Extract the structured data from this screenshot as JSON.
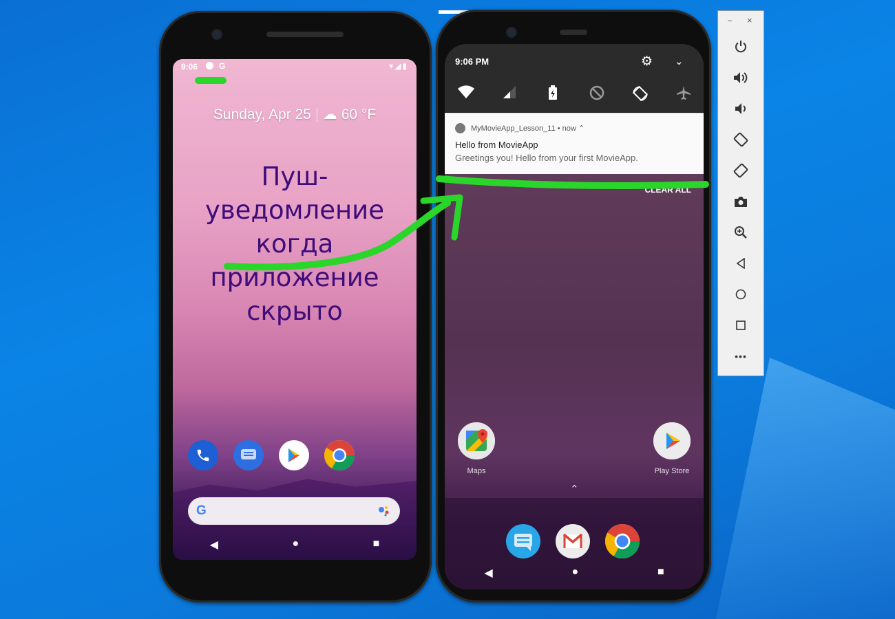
{
  "phone_left": {
    "status_time": "9:06",
    "status_g": "G",
    "status_right": "▾◢▮",
    "date": "Sunday, Apr 25",
    "weather_icon": "☁",
    "temperature": "60 °F",
    "annotation_line1": "Пуш-уведомление",
    "annotation_line2": "когда приложение",
    "annotation_line3": "скрыто",
    "dock_apps": [
      "phone-app",
      "messages-app",
      "play-store-app",
      "chrome-app"
    ],
    "search_logo": "G",
    "nav_back": "◀",
    "nav_home": "●",
    "nav_recent": "■"
  },
  "phone_right": {
    "status_time": "9:06 PM",
    "settings_icon": "⚙",
    "expand_icon": "⌄",
    "quick_settings": [
      "wifi",
      "signal",
      "battery-saver",
      "do-not-disturb",
      "auto-rotate",
      "airplane"
    ],
    "notification": {
      "app_name": "MyMovieApp_Lesson_11 • now ⌃",
      "title": "Hello from MovieApp",
      "body": "Greetings you! Hello from your first MovieApp."
    },
    "clear_all": "CLEAR ALL",
    "home_apps": [
      {
        "label": "Maps"
      },
      {
        "label": "Play Store"
      }
    ],
    "up_caret": "⌃",
    "nav_back": "◀",
    "nav_home": "●",
    "nav_recent": "■"
  },
  "toolbar": {
    "minimize": "–",
    "close": "×",
    "buttons": [
      "power",
      "volume-up",
      "volume-down",
      "rotate-left",
      "rotate-right",
      "screenshot",
      "zoom",
      "back",
      "home",
      "overview",
      "more"
    ],
    "more_label": "•••"
  },
  "colors": {
    "annotation_text": "#3f0c7a",
    "annotation_stroke": "#2bd62b",
    "desktop_bg": "#0a84e6"
  }
}
